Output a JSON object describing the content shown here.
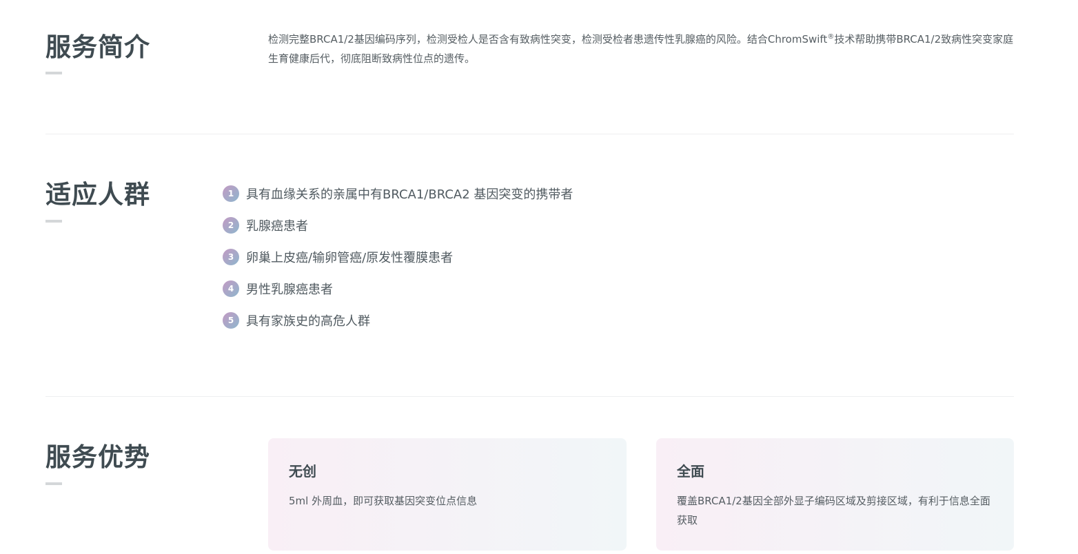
{
  "intro": {
    "title": "服务简介",
    "text_part1": "检测完整BRCA1/2基因编码序列，检测受检人是否含有致病性突变，检测受检者患遗传性乳腺癌的风险。结合ChromSwift",
    "text_sup": "®",
    "text_part2": "技术帮助携带BRCA1/2致病性突变家庭生育健康后代，彻底阻断致病性位点的遗传。"
  },
  "audience": {
    "title": "适应人群",
    "items": [
      {
        "num": "1",
        "label": "具有血缘关系的亲属中有BRCA1/BRCA2 基因突变的携带者"
      },
      {
        "num": "2",
        "label": "乳腺癌患者"
      },
      {
        "num": "3",
        "label": "卵巢上皮癌/输卵管癌/原发性覆膜患者"
      },
      {
        "num": "4",
        "label": "男性乳腺癌患者"
      },
      {
        "num": "5",
        "label": "具有家族史的高危人群"
      }
    ]
  },
  "advantages": {
    "title": "服务优势",
    "cards": [
      {
        "title": "无创",
        "desc": "5ml 外周血，即可获取基因突变位点信息"
      },
      {
        "title": "全面",
        "desc": "覆盖BRCA1/2基因全部外显子编码区域及剪接区域，有利于信息全面获取"
      }
    ]
  },
  "colors": {
    "title": "#3f4b51",
    "badge_gradient_start": "#c39ac3",
    "badge_gradient_end": "#8eb6cd",
    "card_gradient_start": "#f9eff6",
    "card_gradient_end": "#f1f6f8"
  }
}
